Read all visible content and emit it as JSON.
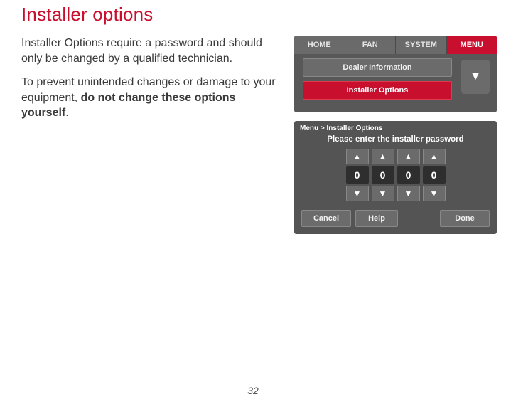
{
  "page": {
    "title": "Installer options",
    "number": "32"
  },
  "text": {
    "p1": "Installer Options require a password and should only be changed by a qualified technician.",
    "p2_a": "To prevent unintended changes or damage to your equipment, ",
    "p2_b": "do not change these options yourself",
    "p2_c": "."
  },
  "screen1": {
    "tabs": {
      "home": "HOME",
      "fan": "FAN",
      "system": "SYSTEM",
      "menu": "MENU"
    },
    "items": {
      "dealer": "Dealer Information",
      "installer": "Installer Options"
    },
    "scroll_icon": "▼"
  },
  "screen2": {
    "crumb": "Menu > Installer Options",
    "prompt": "Please enter the installer password",
    "digits": [
      "0",
      "0",
      "0",
      "0"
    ],
    "buttons": {
      "cancel": "Cancel",
      "help": "Help",
      "done": "Done"
    }
  }
}
